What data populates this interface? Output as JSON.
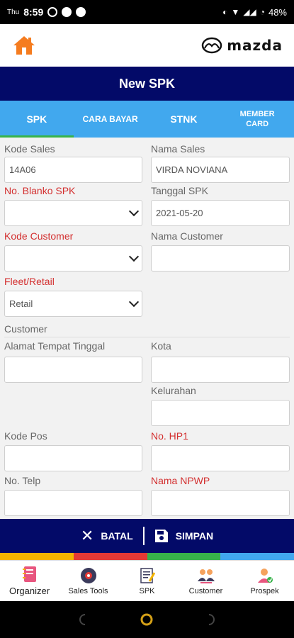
{
  "statusbar": {
    "day": "Thu",
    "time": "8:59",
    "battery": "48%"
  },
  "header": {
    "brand": "mazda"
  },
  "titlebar": {
    "title": "New SPK"
  },
  "tabs": [
    {
      "label": "SPK",
      "active": true
    },
    {
      "label": "CARA BAYAR"
    },
    {
      "label": "STNK"
    },
    {
      "label": "MEMBER CARD"
    }
  ],
  "form": {
    "kode_sales": {
      "label": "Kode Sales",
      "value": "14A06"
    },
    "nama_sales": {
      "label": "Nama Sales",
      "value": "VIRDA NOVIANA"
    },
    "no_blanko_spk": {
      "label": "No. Blanko SPK",
      "value": ""
    },
    "tanggal_spk": {
      "label": "Tanggal SPK",
      "value": "2021-05-20"
    },
    "kode_customer": {
      "label": "Kode Customer",
      "value": ""
    },
    "nama_customer": {
      "label": "Nama Customer",
      "value": ""
    },
    "fleet_retail": {
      "label": "Fleet/Retail",
      "value": "Retail"
    },
    "section_customer": "Customer",
    "alamat": {
      "label": "Alamat Tempat Tinggal",
      "value": ""
    },
    "kota": {
      "label": "Kota",
      "value": ""
    },
    "kelurahan": {
      "label": "Kelurahan",
      "value": ""
    },
    "kode_pos": {
      "label": "Kode Pos",
      "value": ""
    },
    "no_hp1": {
      "label": "No. HP1",
      "value": ""
    },
    "no_telp": {
      "label": "No. Telp",
      "value": ""
    },
    "nama_npwp": {
      "label": "Nama NPWP",
      "value": ""
    }
  },
  "actions": {
    "cancel": "BATAL",
    "save": "SIMPAN"
  },
  "colors": {
    "primary": "#030a68",
    "tab": "#41a8ee",
    "required": "#d32f2f",
    "strip": [
      "#f4b400",
      "#e53935",
      "#37b34a",
      "#41a8ee"
    ]
  },
  "bottomnav": [
    {
      "label": "Organizer",
      "icon": "organizer-icon"
    },
    {
      "label": "Sales Tools",
      "icon": "sales-tools-icon"
    },
    {
      "label": "SPK",
      "icon": "spk-icon"
    },
    {
      "label": "Customer",
      "icon": "customer-icon"
    },
    {
      "label": "Prospek",
      "icon": "prospek-icon"
    }
  ]
}
